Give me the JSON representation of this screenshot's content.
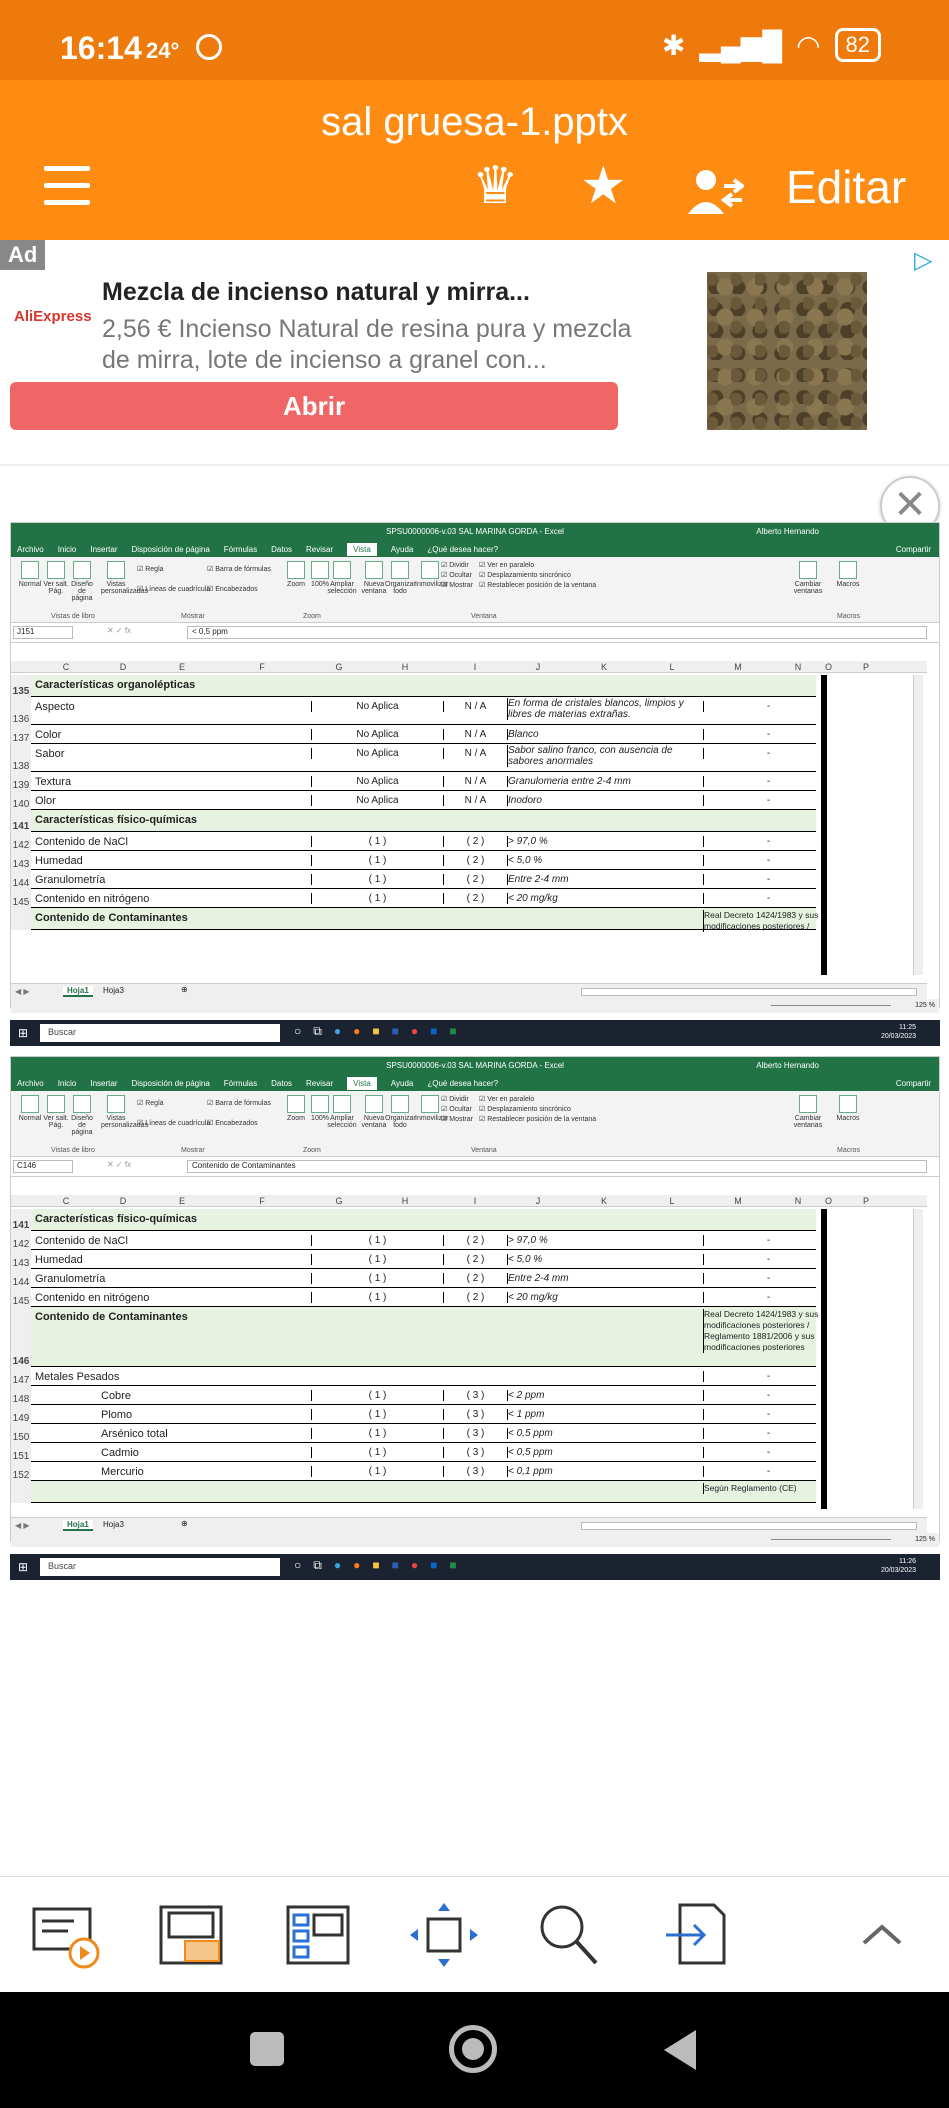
{
  "status": {
    "time": "16:14",
    "temp": "24°",
    "battery": "82"
  },
  "app": {
    "title": "sal gruesa-1.pptx",
    "edit_label": "Editar"
  },
  "ad": {
    "tag": "Ad",
    "brand": "AliExpress",
    "headline": "Mezcla de incienso natural y mirra...",
    "description": "2,56 € Incienso Natural de resina pura y mezcla de mirra, lote de incienso a granel con...",
    "button": "Abrir"
  },
  "excel1": {
    "title": "SPSU0000006-v.03 SAL MARINA GORDA - Excel",
    "user": "Alberto Hernando",
    "tabs": [
      "Archivo",
      "Inicio",
      "Insertar",
      "Disposición de página",
      "Fórmulas",
      "Datos",
      "Revisar",
      "Vista",
      "Ayuda",
      "¿Qué desea hacer?"
    ],
    "share": "Compartir",
    "namebox": "J151",
    "formula": "< 0,5 ppm",
    "groups": [
      "Vistas de libro",
      "Mostrar",
      "Zoom",
      "Ventana",
      "Macros"
    ],
    "cols": [
      "C",
      "D",
      "E",
      "F",
      "G",
      "H",
      "I",
      "J",
      "K",
      "L",
      "M",
      "N",
      "O",
      "P"
    ],
    "sheets": [
      "Hoja1",
      "Hoja3"
    ],
    "zoom": "125 %",
    "clock_time": "11:25",
    "clock_date": "20/03/2023",
    "search": "Buscar"
  },
  "excel2": {
    "namebox": "C146",
    "formula": "Contenido de Contaminantes",
    "clock_time": "11:26",
    "clock_date": "20/03/2023"
  },
  "ribbon": {
    "normal": "Normal",
    "saltos": "Ver salt. Pág.",
    "diseno": "Diseño de página",
    "vistas": "Vistas personalizadas",
    "regla": "Regla",
    "barra": "Barra de fórmulas",
    "lineas": "Líneas de cuadrícula",
    "encab": "Encabezados",
    "zoom": "Zoom",
    "cien": "100%",
    "ampliar": "Ampliar selección",
    "nueva": "Nueva ventana",
    "organizar": "Organizar todo",
    "inmov": "Inmovilizar",
    "dividir": "Dividir",
    "ocultar": "Ocultar",
    "mostrar": "Mostrar",
    "paralelo": "Ver en paralelo",
    "sincronico": "Desplazamiento sincrónico",
    "restablecer": "Restablecer posición de la ventana",
    "cambiar": "Cambiar ventanas",
    "macros": "Macros"
  },
  "table1": [
    {
      "n": "135",
      "type": "sec",
      "c": "Características organolépticas"
    },
    {
      "n": "136",
      "c": "Aspecto",
      "g": "No Aplica",
      "i": "N / A",
      "j": "En forma de cristales blancos, limpios y libres de materias extrañas.",
      "m": "-"
    },
    {
      "n": "137",
      "c": "Color",
      "g": "No Aplica",
      "i": "N / A",
      "j": "Blanco",
      "m": "-"
    },
    {
      "n": "138",
      "c": "Sabor",
      "g": "No Aplica",
      "i": "N / A",
      "j": "Sabor salino franco, con ausencia de sabores anormales",
      "m": "-"
    },
    {
      "n": "139",
      "c": "Textura",
      "g": "No Aplica",
      "i": "N / A",
      "j": "Granulomeria entre 2-4 mm",
      "m": "-"
    },
    {
      "n": "140",
      "c": "Olor",
      "g": "No Aplica",
      "i": "N / A",
      "j": "Inodoro",
      "m": "-"
    },
    {
      "n": "141",
      "type": "sec",
      "c": "Características físico-químicas"
    },
    {
      "n": "142",
      "c": "Contenido de NaCl",
      "g": "( 1 )",
      "i": "( 2 )",
      "j": "> 97,0 %",
      "m": "-"
    },
    {
      "n": "143",
      "c": "Humedad",
      "g": "( 1 )",
      "i": "( 2 )",
      "j": "< 5,0  %",
      "m": "-"
    },
    {
      "n": "144",
      "c": "Granulometría",
      "g": "( 1 )",
      "i": "( 2 )",
      "j": "Entre 2-4 mm",
      "m": "-"
    },
    {
      "n": "145",
      "c": "Contenido en nitrógeno",
      "g": "( 1 )",
      "i": "( 2 )",
      "j": "< 20 mg/kg",
      "m": "-"
    },
    {
      "n": "",
      "type": "sec",
      "c": "Contenido de Contaminantes",
      "m": "Real Decreto 1424/1983 y sus modificaciones posteriores /"
    }
  ],
  "table2": [
    {
      "n": "141",
      "type": "sec",
      "c": "Características físico-químicas"
    },
    {
      "n": "142",
      "c": "Contenido de NaCl",
      "g": "( 1 )",
      "i": "( 2 )",
      "j": "> 97,0 %",
      "m": "-"
    },
    {
      "n": "143",
      "c": "Humedad",
      "g": "( 1 )",
      "i": "( 2 )",
      "j": "< 5,0  %",
      "m": "-"
    },
    {
      "n": "144",
      "c": "Granulometría",
      "g": "( 1 )",
      "i": "( 2 )",
      "j": "Entre 2-4 mm",
      "m": "-"
    },
    {
      "n": "145",
      "c": "Contenido en nitrógeno",
      "g": "( 1 )",
      "i": "( 2 )",
      "j": "< 20 mg/kg",
      "m": "-"
    },
    {
      "n": "146",
      "type": "sec",
      "c": "Contenido de Contaminantes",
      "m": "Real Decreto 1424/1983 y sus modificaciones posteriores / Reglamento 1881/2006 y sus modificaciones posteriores"
    },
    {
      "n": "147",
      "c": "Metales Pesados",
      "m": "-"
    },
    {
      "n": "148",
      "c": "Cobre",
      "indent": true,
      "g": "( 1 )",
      "i": "( 3 )",
      "j": "< 2 ppm",
      "m": "-"
    },
    {
      "n": "149",
      "c": "Plomo",
      "indent": true,
      "g": "( 1 )",
      "i": "( 3 )",
      "j": "< 1 ppm",
      "m": "-"
    },
    {
      "n": "150",
      "c": "Arsénico total",
      "indent": true,
      "g": "( 1 )",
      "i": "( 3 )",
      "j": "< 0,5 ppm",
      "m": "-"
    },
    {
      "n": "151",
      "c": "Cadmio",
      "indent": true,
      "g": "( 1 )",
      "i": "( 3 )",
      "j": "< 0,5 ppm",
      "m": "-"
    },
    {
      "n": "152",
      "c": "Mercurio",
      "indent": true,
      "g": "( 1 )",
      "i": "( 3 )",
      "j": "< 0,1 ppm",
      "m": "-"
    },
    {
      "n": "",
      "type": "sec",
      "c": "",
      "m": "Según Reglamento (CE)"
    }
  ]
}
